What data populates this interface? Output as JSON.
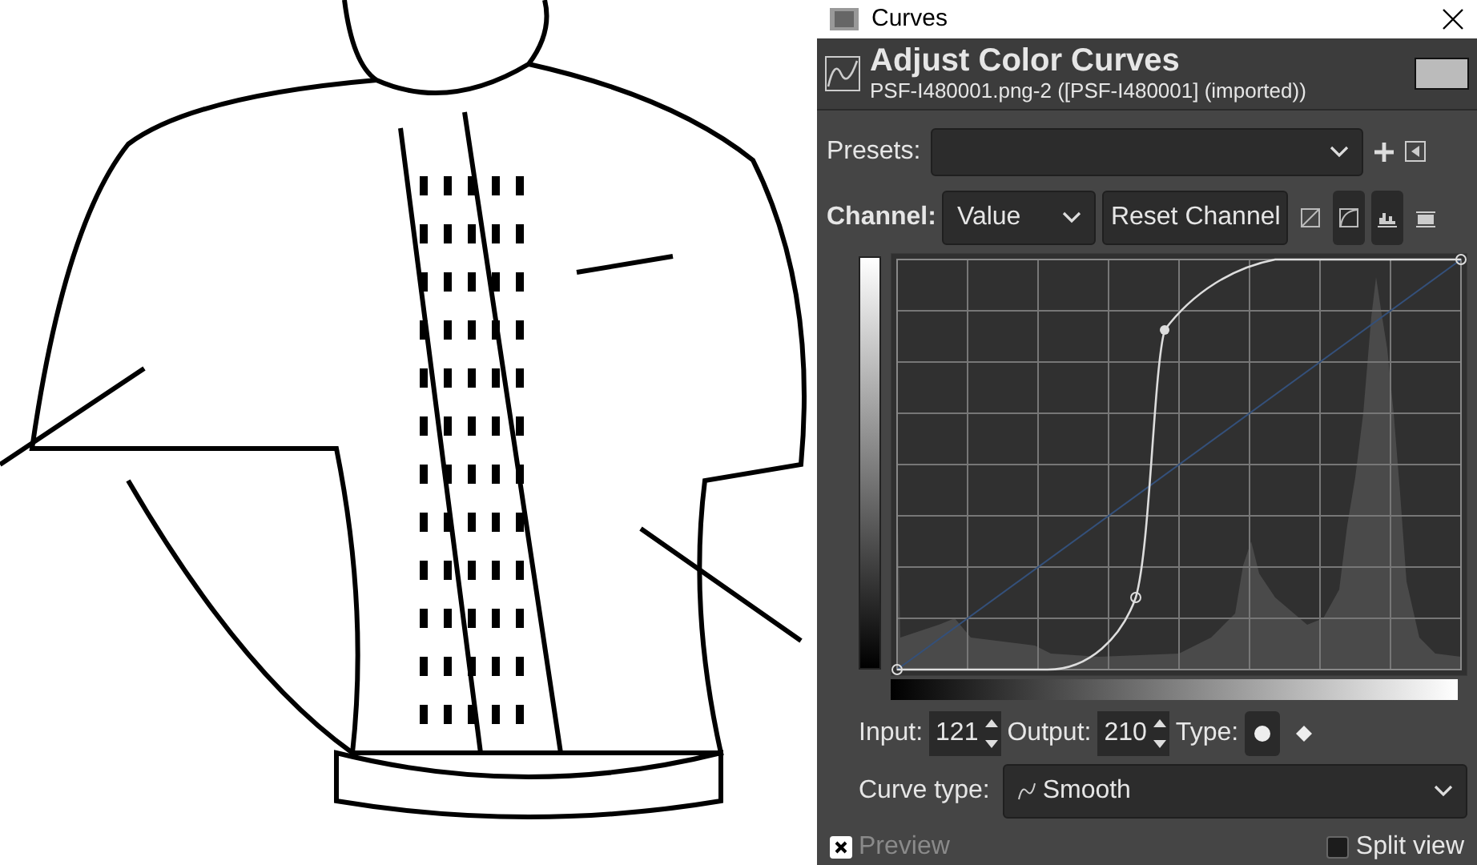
{
  "window": {
    "title": "Curves"
  },
  "header": {
    "title": "Adjust Color Curves",
    "subtitle": "PSF-I480001.png-2 ([PSF-I480001] (imported))"
  },
  "presets": {
    "label": "Presets:"
  },
  "channel": {
    "label": "Channel:",
    "value": "Value",
    "reset_button": "Reset Channel",
    "scale_buttons": [
      {
        "kind": "linear",
        "selected": false
      },
      {
        "kind": "log",
        "selected": true
      }
    ],
    "histogram_buttons": [
      {
        "kind": "linear",
        "selected": true
      },
      {
        "kind": "log",
        "selected": false
      }
    ]
  },
  "point": {
    "input_label": "Input:",
    "input": "121",
    "output_label": "Output:",
    "output": "210",
    "type_label": "Type:",
    "types": [
      {
        "kind": "smooth",
        "selected": true
      },
      {
        "kind": "corner",
        "selected": false
      }
    ]
  },
  "curve_type": {
    "label": "Curve type:",
    "value": "Smooth"
  },
  "preview": {
    "label": "Preview",
    "checked": true
  },
  "split_view": {
    "label": "Split view",
    "checked": false
  }
}
